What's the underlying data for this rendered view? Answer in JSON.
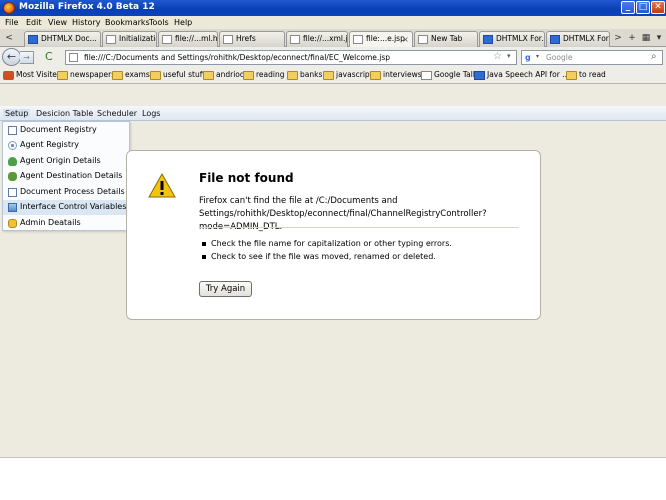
{
  "window": {
    "title": "Mozilla Firefox 4.0 Beta 12",
    "min": "_",
    "max": "□",
    "close": "✕"
  },
  "menubar": [
    "File",
    "Edit",
    "View",
    "History",
    "Bookmarks",
    "Tools",
    "Help"
  ],
  "tabbar": {
    "back_scroll": "<",
    "tabs": [
      {
        "label": "DHTMLX Doc...",
        "icon": "dhtmlx-icon",
        "active": false
      },
      {
        "label": "Initialization ...",
        "icon": "page-icon",
        "active": false
      },
      {
        "label": "file://...ml.html",
        "icon": "page-icon",
        "active": false
      },
      {
        "label": "Hrefs",
        "icon": "page-icon",
        "active": false
      },
      {
        "label": "file://...xml.jsp",
        "icon": "page-icon",
        "active": false
      },
      {
        "label": "file:...e.jsp",
        "icon": "page-icon",
        "active": true
      },
      {
        "label": "New Tab",
        "icon": "page-icon",
        "active": false
      },
      {
        "label": "DHTMLX For...",
        "icon": "dhtmlx-icon",
        "active": false
      },
      {
        "label": "DHTMLX For...",
        "icon": "dhtmlx-icon",
        "active": false
      }
    ],
    "scroll_right": ">",
    "new_tab": "+",
    "list_all": "▾",
    "extra1": "▦",
    "extra2": "▾"
  },
  "navbar": {
    "back": "←",
    "forward": "→",
    "reload": "C",
    "url": "file:///C:/Documents and Settings/rohithk/Desktop/econnect/final/EC_Welcome.jsp",
    "bookmark_star": "☆",
    "url_dropdown": "▾",
    "search_engine": "g",
    "search_placeholder": "Google",
    "search_button": "⌕"
  },
  "bookmarks": [
    {
      "label": "Most Visited",
      "icon": "most-visited-icon"
    },
    {
      "label": "newspapers",
      "icon": "folder-icon"
    },
    {
      "label": "exams",
      "icon": "folder-icon"
    },
    {
      "label": "useful stuff",
      "icon": "folder-icon"
    },
    {
      "label": "andriod",
      "icon": "folder-icon"
    },
    {
      "label": "reading",
      "icon": "folder-icon"
    },
    {
      "label": "banks",
      "icon": "folder-icon"
    },
    {
      "label": "javascript",
      "icon": "folder-icon"
    },
    {
      "label": "interviews",
      "icon": "folder-icon"
    },
    {
      "label": "Google Talk",
      "icon": "page-icon"
    },
    {
      "label": "Java Speech API for ...",
      "icon": "ask-icon"
    },
    {
      "label": "to read",
      "icon": "folder-icon"
    }
  ],
  "appmenu": [
    "Setup",
    "Desicion Table",
    "Scheduler",
    "Logs"
  ],
  "dropdown": [
    {
      "label": "Document Registry",
      "icon": "document-icon"
    },
    {
      "label": "Agent Registry",
      "icon": "network-icon"
    },
    {
      "label": "Agent Origin Details",
      "icon": "agent-icon"
    },
    {
      "label": "Agent Destination Details",
      "icon": "agent-destination-icon"
    },
    {
      "label": "Document Process Details",
      "icon": "document-process-icon"
    },
    {
      "label": "Interface Control Variables",
      "icon": "interface-icon"
    },
    {
      "label": "Admin Deatails",
      "icon": "admin-icon"
    }
  ],
  "error": {
    "title": "File not found",
    "description": "Firefox can't find the file at /C:/Documents and Settings/rohithk/Desktop/econnect/final/ChannelRegistryController?mode=ADMIN_DTL.",
    "tips": [
      "Check the file name for capitalization or other typing errors.",
      "Check to see if the file was moved, renamed or deleted."
    ],
    "button": "Try Again"
  },
  "colors": {
    "titlebar": "#0a3fb5",
    "content_bg": "#edebe0",
    "app_menu": "#dfe7f1",
    "warning": "#f2c40f"
  }
}
